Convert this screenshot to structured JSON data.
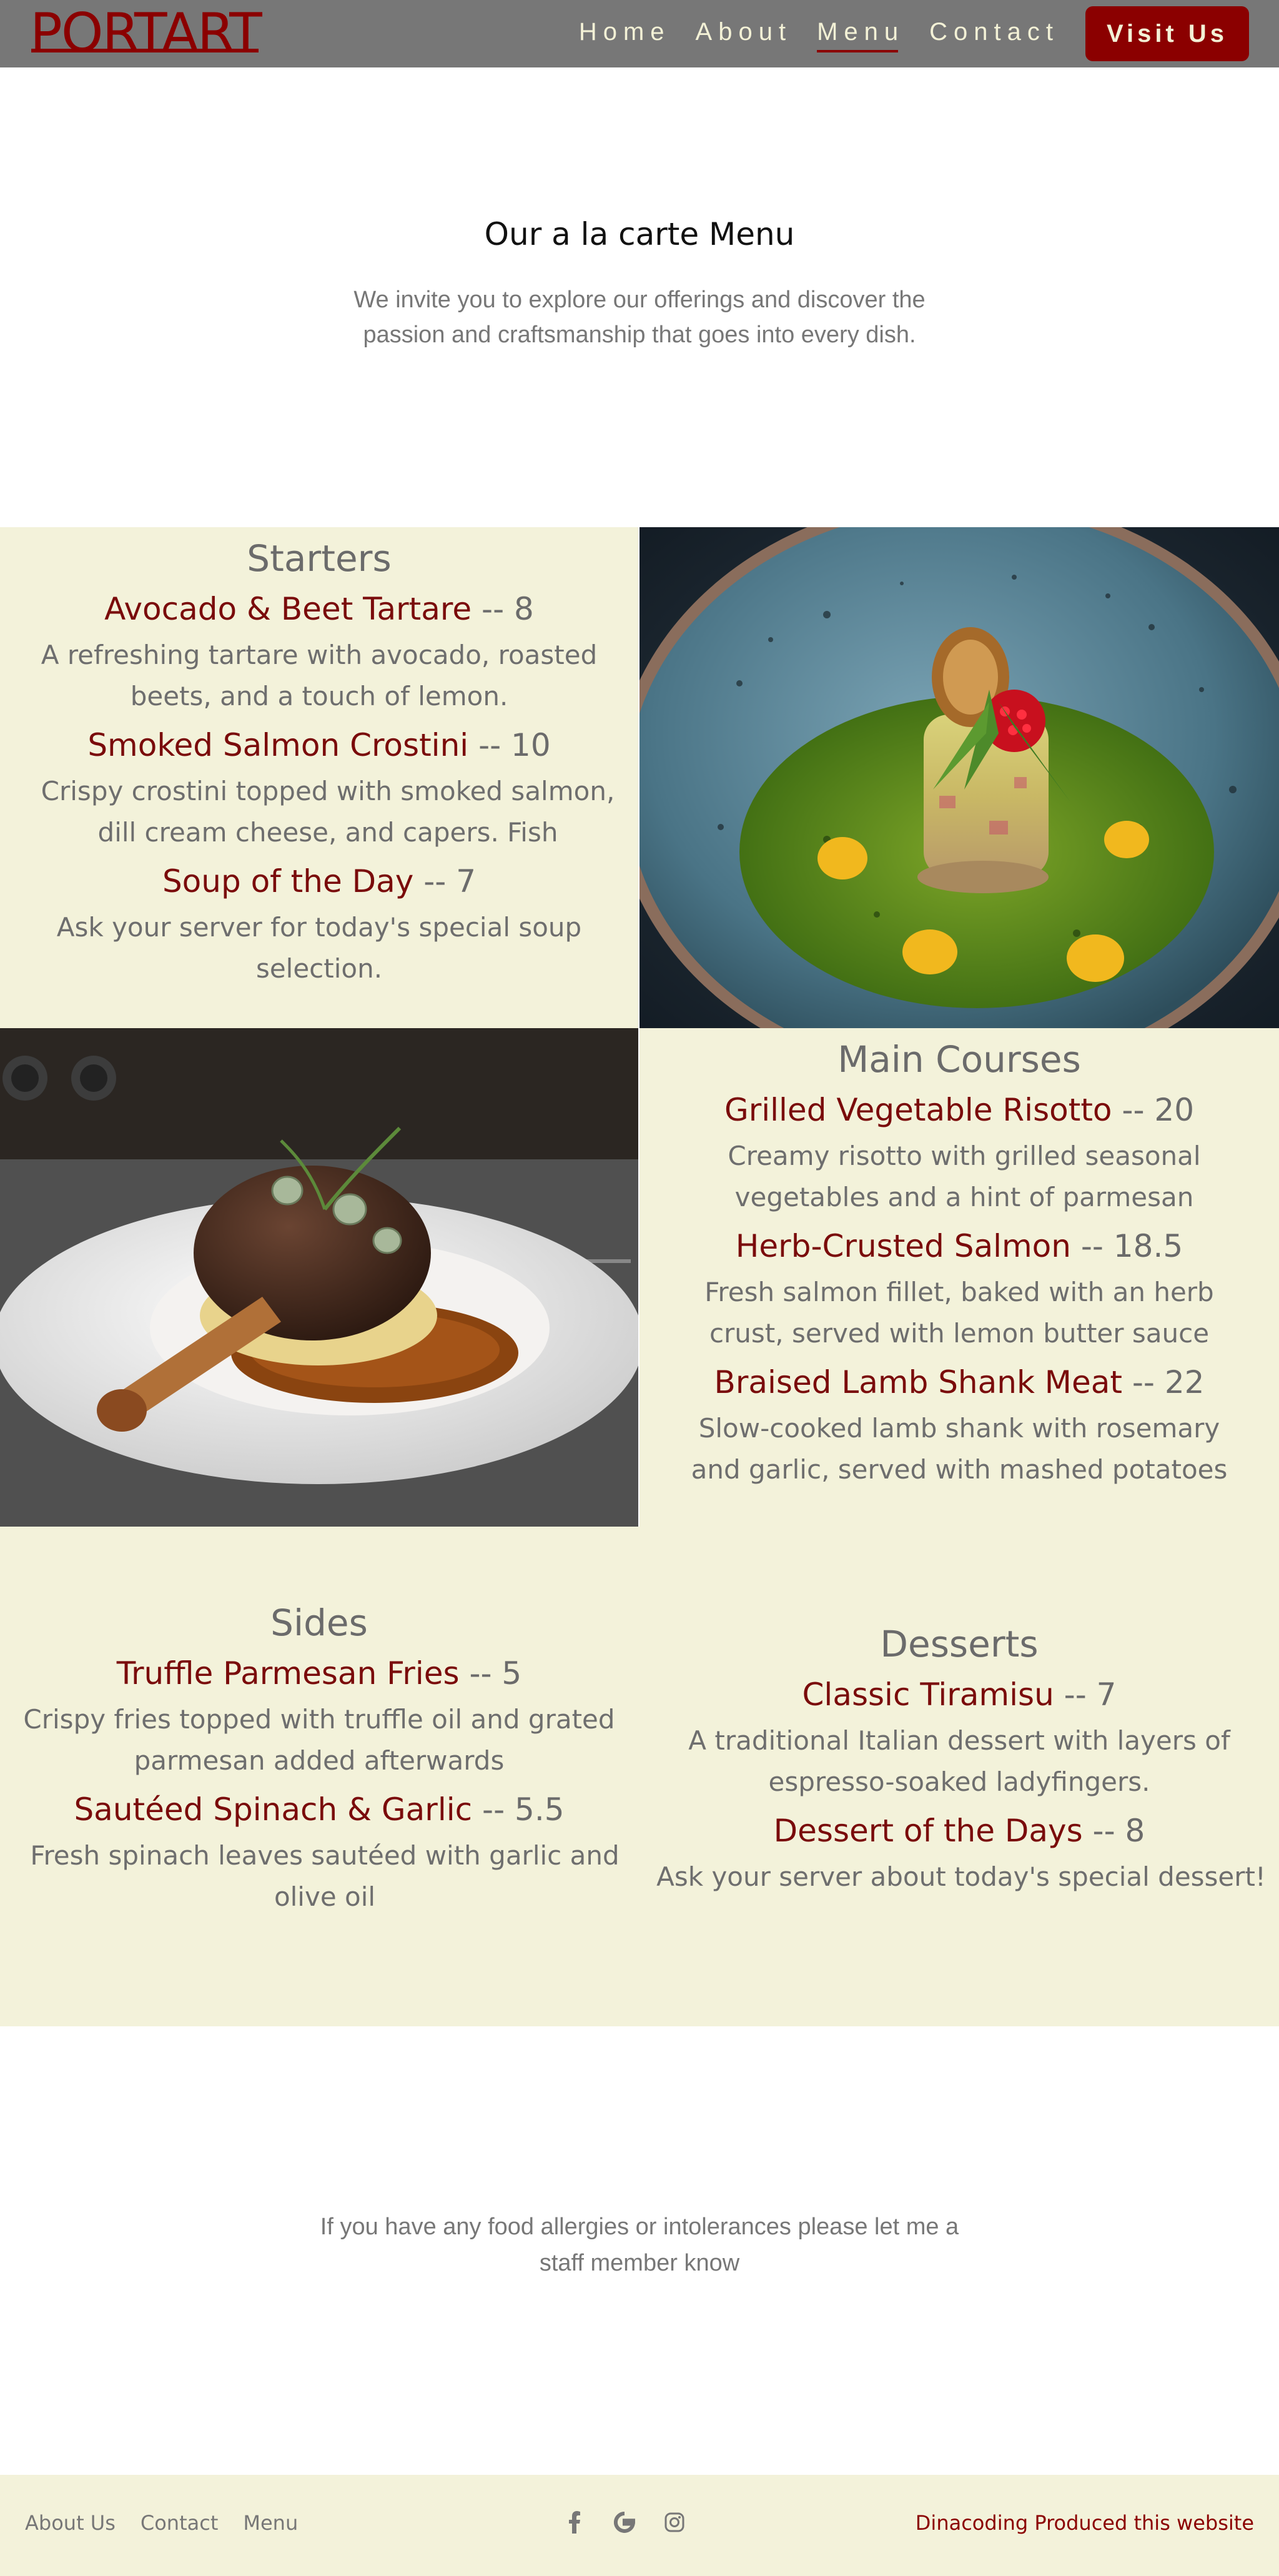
{
  "nav": {
    "logo": "PORTART",
    "links": [
      "Home",
      "About",
      "Menu",
      "Contact"
    ],
    "active": "Menu",
    "cta": "Visit Us",
    "colors": {
      "bar": "#777777",
      "accent": "#8b0000",
      "link": "#f3f1d6"
    }
  },
  "intro": {
    "title": "Our a la carte Menu",
    "text": "We invite you to explore our offerings and discover the passion and craftsmanship that goes into every dish."
  },
  "starters": {
    "title": "Starters",
    "items": [
      {
        "name": "Avocado & Beet Tartare",
        "price": "-- 8",
        "desc": "A refreshing tartare with avocado, roasted beets, and a touch of lemon."
      },
      {
        "name": "Smoked Salmon Crostini",
        "price": "-- 10",
        "desc": "Crispy crostini topped with smoked salmon, dill cream cheese, and capers. Fish"
      },
      {
        "name": "Soup of the Day",
        "price": "-- 7",
        "desc": "Ask your server for today's special soup selection."
      }
    ]
  },
  "mains": {
    "title": "Main Courses",
    "items": [
      {
        "name": "Grilled Vegetable Risotto",
        "price": "-- 20",
        "desc": "Creamy risotto with grilled seasonal vegetables and a hint of parmesan"
      },
      {
        "name": "Herb-Crusted Salmon",
        "price": "-- 18.5",
        "desc": "Fresh salmon fillet, baked with an herb crust, served with lemon butter sauce"
      },
      {
        "name": "Braised Lamb Shank Meat",
        "price": "-- 22",
        "desc": "Slow-cooked lamb shank with rosemary and garlic, served with mashed potatoes"
      }
    ]
  },
  "sides": {
    "title": "Sides",
    "items": [
      {
        "name": "Truffle Parmesan Fries",
        "price": "-- 5",
        "desc": "Crispy fries topped with truffle oil and grated parmesan added afterwards"
      },
      {
        "name": "Sautéed Spinach & Garlic",
        "price": "-- 5.5",
        "desc": "Fresh spinach leaves sautéed with garlic and olive oil"
      }
    ]
  },
  "desserts": {
    "title": "Desserts",
    "items": [
      {
        "name": "Classic Tiramisu",
        "price": "-- 7",
        "desc": "A traditional Italian dessert with layers of espresso-soaked ladyfingers."
      },
      {
        "name": "Dessert of the Days",
        "price": "-- 8",
        "desc": "Ask your server about today's special dessert!"
      }
    ]
  },
  "allergy": "If you have any food allergies or intolerances please let me a staff member know",
  "footer": {
    "links": [
      "About Us",
      "Contact",
      "Menu"
    ],
    "icons": [
      "facebook-icon",
      "google-icon",
      "instagram-icon"
    ],
    "credit": "Dinacoding Produced this website"
  },
  "colors": {
    "panel": "#f3f2da",
    "dish_name": "#7a0b0b"
  }
}
